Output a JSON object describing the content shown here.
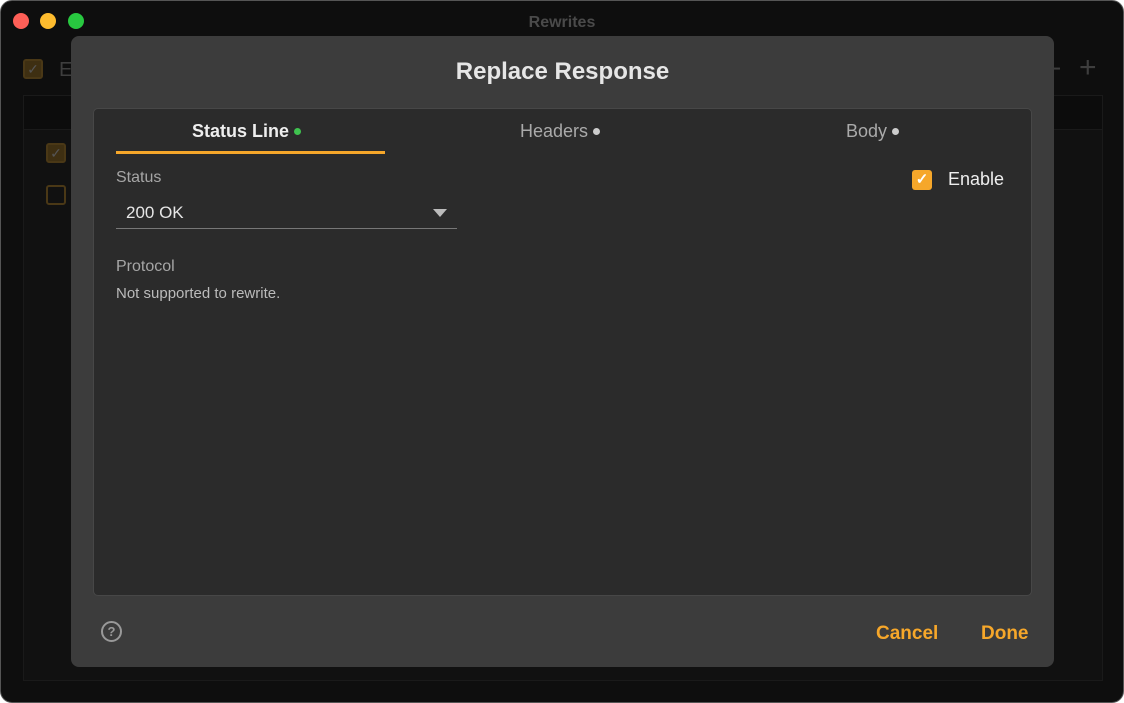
{
  "window": {
    "title": "Rewrites",
    "enable_label": "E",
    "buttons": {
      "remove": "−",
      "add": "+"
    }
  },
  "dialog": {
    "title": "Replace Response",
    "tabs": [
      {
        "label": "Status Line",
        "dot_color": "#3fc34f",
        "active": true
      },
      {
        "label": "Headers",
        "dot_color": "#cccccc",
        "active": false
      },
      {
        "label": "Body",
        "dot_color": "#cccccc",
        "active": false
      }
    ],
    "status": {
      "label": "Status",
      "value": "200 OK"
    },
    "protocol": {
      "label": "Protocol",
      "note": "Not supported to rewrite."
    },
    "enable": {
      "label": "Enable",
      "checked": true,
      "check": "✓"
    },
    "help": "?",
    "cancel": "Cancel",
    "done": "Done"
  },
  "colors": {
    "accent": "#f6a72a"
  }
}
